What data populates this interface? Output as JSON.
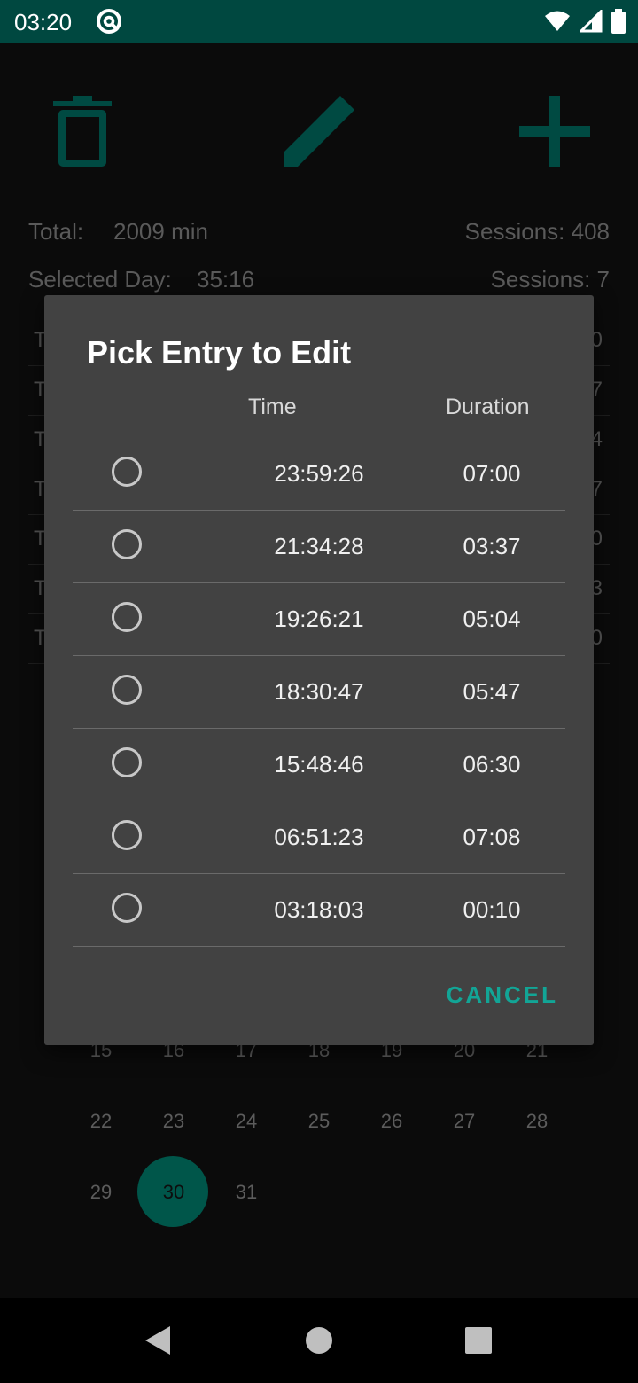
{
  "status_bar": {
    "time": "03:20"
  },
  "background": {
    "total_label": "Total:",
    "total_value": "2009 min",
    "sessions_total": "Sessions: 408",
    "selected_day_label": "Selected Day:",
    "selected_day_value": "35:16",
    "sessions_day": "Sessions: 7",
    "list_left": [
      "T",
      "T",
      "T",
      "T",
      "T",
      "T",
      "T"
    ],
    "list_right": [
      "0",
      "7",
      "4",
      "7",
      "0",
      "3",
      "0"
    ],
    "calendar": {
      "row1": [
        "15",
        "16",
        "17",
        "18",
        "19",
        "20",
        "21"
      ],
      "row2": [
        "22",
        "23",
        "24",
        "25",
        "26",
        "27",
        "28"
      ],
      "row3": [
        "29",
        "30",
        "31"
      ],
      "selected": "30"
    }
  },
  "dialog": {
    "title": "Pick Entry to Edit",
    "headers": {
      "time": "Time",
      "duration": "Duration"
    },
    "entries": [
      {
        "time": "23:59:26",
        "duration": "07:00"
      },
      {
        "time": "21:34:28",
        "duration": "03:37"
      },
      {
        "time": "19:26:21",
        "duration": "05:04"
      },
      {
        "time": "18:30:47",
        "duration": "05:47"
      },
      {
        "time": "15:48:46",
        "duration": "06:30"
      },
      {
        "time": "06:51:23",
        "duration": "07:08"
      },
      {
        "time": "03:18:03",
        "duration": "00:10"
      }
    ],
    "cancel_label": "CANCEL"
  },
  "colors": {
    "accent": "#12a596",
    "status_bar": "#004840",
    "dialog_bg": "#424242"
  }
}
